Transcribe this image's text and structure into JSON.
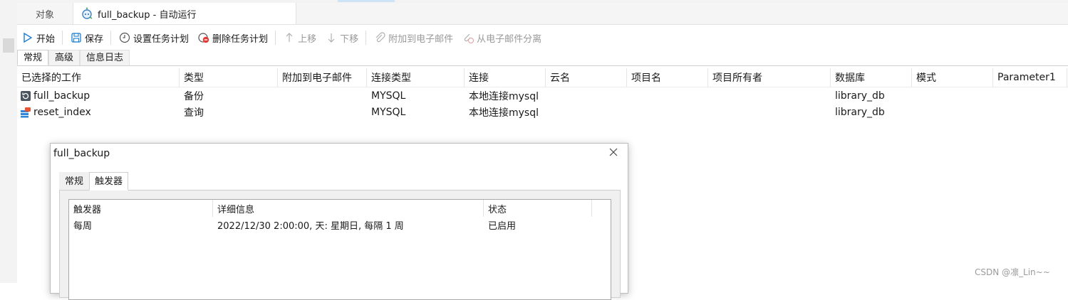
{
  "window": {
    "accent": "#1a7fd4"
  },
  "doc_tabs": {
    "objects": "对象",
    "active_title": "full_backup - 自动运行"
  },
  "toolbar": {
    "start": "开始",
    "save": "保存",
    "set_schedule": "设置任务计划",
    "delete_schedule": "删除任务计划",
    "move_up": "上移",
    "move_down": "下移",
    "attach_email": "附加到电子邮件",
    "detach_email": "从电子邮件分离"
  },
  "sub_tabs": [
    "常规",
    "高级",
    "信息日志"
  ],
  "jobs": {
    "columns": [
      "已选择的工作",
      "类型",
      "附加到电子邮件",
      "连接类型",
      "连接",
      "云名",
      "项目名",
      "项目所有者",
      "数据库",
      "模式",
      "Parameter1"
    ],
    "rows": [
      {
        "icon": "backup-icon",
        "name": "full_backup",
        "type": "备份",
        "email": "",
        "conn_type": "MYSQL",
        "conn": "本地连接mysql",
        "cloud": "",
        "project": "",
        "owner": "",
        "db": "library_db",
        "schema": "",
        "param1": ""
      },
      {
        "icon": "query-icon",
        "name": "reset_index",
        "type": "查询",
        "email": "",
        "conn_type": "MYSQL",
        "conn": "本地连接mysql",
        "cloud": "",
        "project": "",
        "owner": "",
        "db": "library_db",
        "schema": "",
        "param1": ""
      }
    ]
  },
  "dialog": {
    "title": "full_backup",
    "tabs": [
      "常规",
      "触发器"
    ],
    "active_tab": "触发器",
    "triggers": {
      "columns": [
        "触发器",
        "详细信息",
        "状态"
      ],
      "rows": [
        {
          "trigger": "每周",
          "details": "2022/12/30 2:00:00, 天: 星期日, 每隔 1 周",
          "status": "已启用"
        }
      ]
    }
  },
  "watermark": "CSDN @凛_Lin~~"
}
